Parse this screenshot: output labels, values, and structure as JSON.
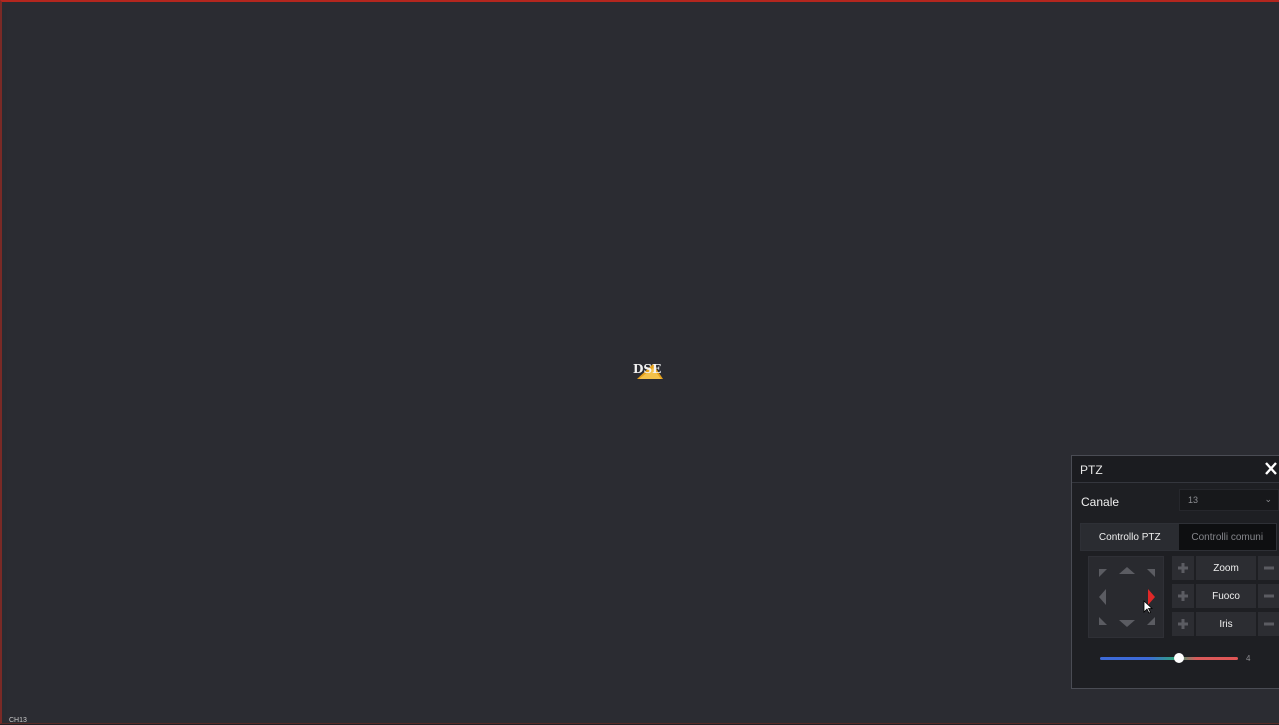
{
  "video": {
    "channel_label": "CH13",
    "logo_text": "DSE"
  },
  "ptz": {
    "title": "PTZ",
    "close_icon": "close-icon",
    "canale_label": "Canale",
    "canale_value": "13",
    "tabs": [
      {
        "label": "Controllo PTZ",
        "active": true
      },
      {
        "label": "Controlli comuni",
        "active": false
      }
    ],
    "dpad_active_direction": "right",
    "lens_controls": [
      {
        "label": "Zoom"
      },
      {
        "label": "Fuoco"
      },
      {
        "label": "Iris"
      }
    ],
    "speed": {
      "value": "4",
      "min": 1,
      "max": 8,
      "fraction": 0.57
    }
  },
  "colors": {
    "frame_border": "#b3261e",
    "active_arrow": "#e02828",
    "speed_low": "#3d6ad8",
    "speed_mid": "#2fa57a",
    "speed_high": "#e05555"
  }
}
